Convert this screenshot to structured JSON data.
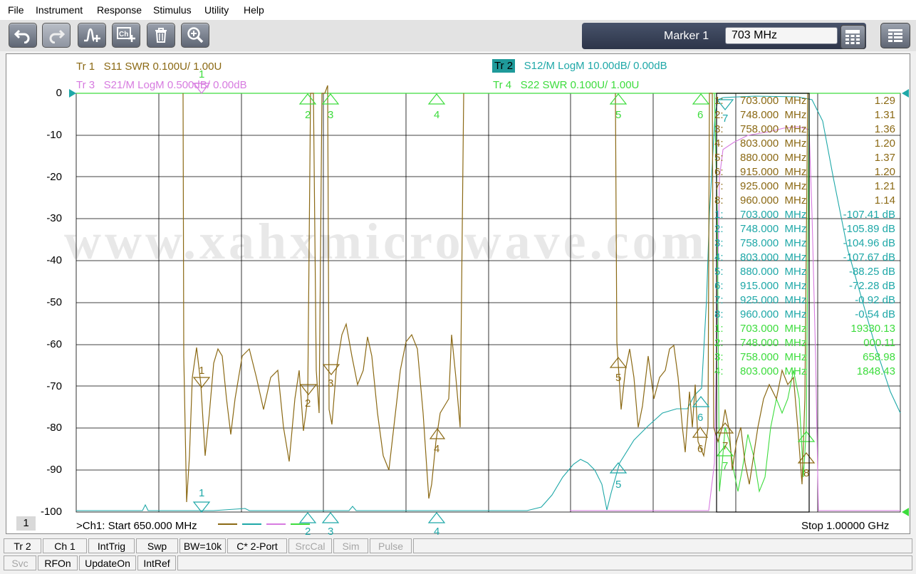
{
  "menu": [
    "File",
    "Instrument",
    "Response",
    "Stimulus",
    "Utility",
    "Help"
  ],
  "toolbar": {
    "buttons": [
      {
        "name": "undo-button",
        "icon": "undo-icon"
      },
      {
        "name": "redo-button",
        "icon": "redo-icon"
      },
      {
        "name": "add-trace-button",
        "icon": "add-trace-icon"
      },
      {
        "name": "add-channel-button",
        "icon": "add-channel-icon"
      },
      {
        "name": "delete-button",
        "icon": "trash-icon"
      },
      {
        "name": "zoom-button",
        "icon": "zoom-icon"
      }
    ],
    "marker_label": "Marker 1",
    "marker_value": "703 MHz"
  },
  "traces": {
    "tr1": {
      "id": "Tr 1",
      "desc": "S11 SWR 0.100U/  1.00U",
      "color": "#8b6914"
    },
    "tr2": {
      "id": "Tr 2",
      "desc": "S12/M LogM 10.00dB/  0.00dB",
      "color": "#1fa8a8"
    },
    "tr3": {
      "id": "Tr 3",
      "desc": "S21/M LogM 0.500dB/  0.00dB",
      "color": "#d77be0"
    },
    "tr4": {
      "id": "Tr 4",
      "desc": "S22 SWR 0.100U/  1.00U",
      "color": "#3ddc3d"
    }
  },
  "yaxis": [
    "0",
    "-10",
    "-20",
    "-30",
    "-40",
    "-50",
    "-60",
    "-70",
    "-80",
    "-90",
    "-100"
  ],
  "watermark": "www.xahxmicrowave.com",
  "markers_table": [
    {
      "n": "1:",
      "f": "703.000  MHz",
      "v": "1.29",
      "t": 1
    },
    {
      "n": "2:",
      "f": "748.000  MHz",
      "v": "1.31",
      "t": 1
    },
    {
      "n": "3:",
      "f": "758.000  MHz",
      "v": "1.36",
      "t": 1
    },
    {
      "n": "4:",
      "f": "803.000  MHz",
      "v": "1.20",
      "t": 1
    },
    {
      "n": "5:",
      "f": "880.000  MHz",
      "v": "1.37",
      "t": 1
    },
    {
      "n": "6:",
      "f": "915.000  MHz",
      "v": "1.20",
      "t": 1
    },
    {
      "n": "7:",
      "f": "925.000  MHz",
      "v": "1.21",
      "t": 1
    },
    {
      "n": "8:",
      "f": "960.000  MHz",
      "v": "1.14",
      "t": 1
    },
    {
      "n": "1:",
      "f": "703.000  MHz",
      "v": "-107.41 dB",
      "t": 2
    },
    {
      "n": "2:",
      "f": "748.000  MHz",
      "v": "-105.89 dB",
      "t": 2
    },
    {
      "n": "3:",
      "f": "758.000  MHz",
      "v": "-104.96 dB",
      "t": 2
    },
    {
      "n": "4:",
      "f": "803.000  MHz",
      "v": "-107.67 dB",
      "t": 2
    },
    {
      "n": "5:",
      "f": "880.000  MHz",
      "v": "-88.25 dB",
      "t": 2
    },
    {
      "n": "6:",
      "f": "915.000  MHz",
      "v": "-72.28 dB",
      "t": 2
    },
    {
      "n": "7:",
      "f": "925.000  MHz",
      "v": "-0.92 dB",
      "t": 2
    },
    {
      "n": "8:",
      "f": "960.000  MHz",
      "v": "-0.54 dB",
      "t": 2
    },
    {
      "n": "1:",
      "f": "703.000  MHz",
      "v": "19330.13",
      "t": 4
    },
    {
      "n": "2:",
      "f": "748.000  MHz",
      "v": "000.11",
      "t": 4
    },
    {
      "n": "3:",
      "f": "758.000  MHz",
      "v": "658.98",
      "t": 4
    },
    {
      "n": "4:",
      "f": "803.000  MHz",
      "v": "1848.43",
      "t": 4
    }
  ],
  "channel_number": "1",
  "start_label": ">Ch1:  Start  650.000 MHz",
  "stop_label": "Stop  1.00000 GHz",
  "marker_ids": {
    "m1": "1",
    "m2": "2",
    "m3": "3",
    "m4": "4",
    "m5": "5",
    "m6": "6",
    "m7": "7",
    "m8": "8"
  },
  "status_row1": [
    {
      "label": "Tr 2",
      "dim": false
    },
    {
      "label": "Ch 1",
      "dim": false
    },
    {
      "label": "IntTrig",
      "dim": false
    },
    {
      "label": "Swp",
      "dim": false
    },
    {
      "label": "BW=10k",
      "dim": false
    },
    {
      "label": "C* 2-Port",
      "dim": false
    },
    {
      "label": "SrcCal",
      "dim": true
    },
    {
      "label": "Sim",
      "dim": true
    },
    {
      "label": "Pulse",
      "dim": true
    }
  ],
  "status_row2": [
    {
      "label": "Svc",
      "dim": true
    },
    {
      "label": "RFOn",
      "dim": false
    },
    {
      "label": "UpdateOn",
      "dim": false
    },
    {
      "label": "IntRef",
      "dim": false
    }
  ]
}
